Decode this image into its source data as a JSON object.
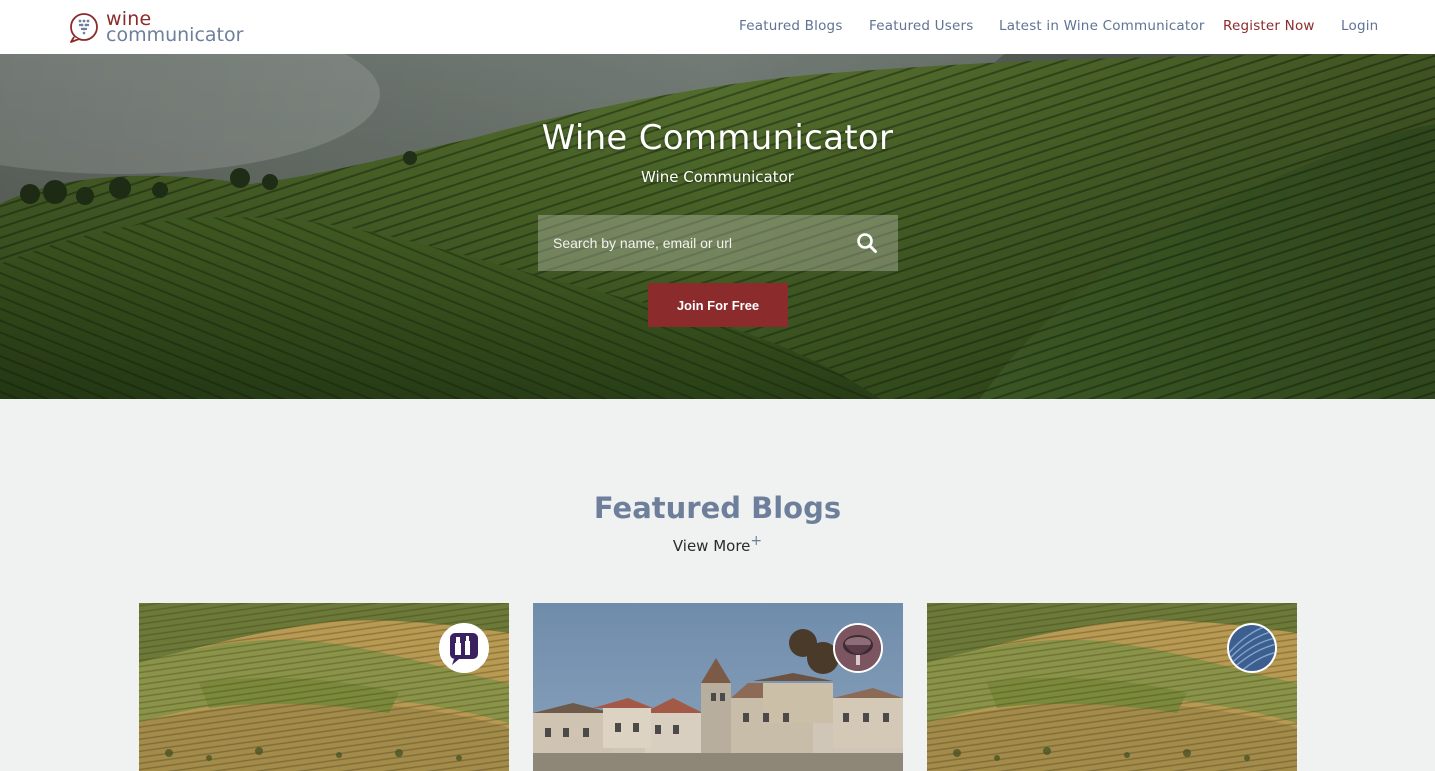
{
  "nav": {
    "logo_top": "wine",
    "logo_bottom": "communicator",
    "links": [
      {
        "label": "Featured Blogs"
      },
      {
        "label": "Featured Users"
      },
      {
        "label": "Latest in Wine Communicator"
      },
      {
        "label": "Register Now"
      },
      {
        "label": "Login"
      }
    ]
  },
  "hero": {
    "title": "Wine Communicator",
    "subtitle": "Wine Communicator",
    "search_placeholder": "Search by name, email or url",
    "join_label": "Join For Free"
  },
  "featured": {
    "title": "Featured Blogs",
    "view_more": "View More",
    "view_more_plus": "+",
    "cards": [
      {
        "image": "douro-vineyard-terraces",
        "avatar_icon": "wine-bottle-chat-icon"
      },
      {
        "image": "village-church-rooftops",
        "avatar_icon": "wine-glass-avatar-icon"
      },
      {
        "image": "douro-vineyard-terraces",
        "avatar_icon": "blue-swirl-avatar-icon"
      }
    ]
  },
  "colors": {
    "brand_red": "#8b2b2b",
    "brand_blue": "#6e7f9c",
    "page_bg": "#f0f2f1"
  }
}
